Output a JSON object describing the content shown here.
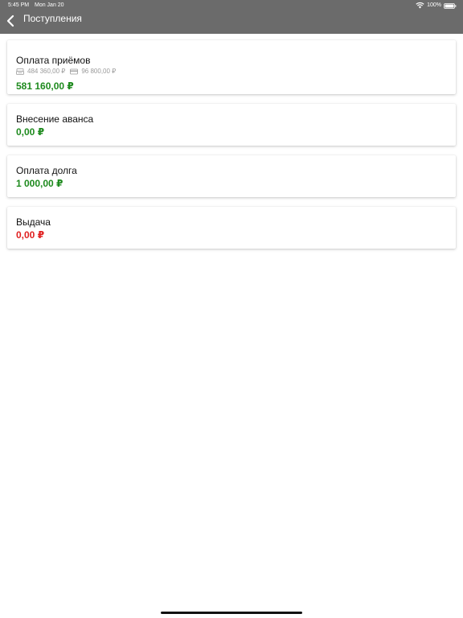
{
  "status_bar": {
    "time": "5:45 PM",
    "date": "Mon Jan 20",
    "battery": "100%"
  },
  "header": {
    "title": "Поступления",
    "back_icon": "chevron-left-icon",
    "background_color": "#6b6b6b"
  },
  "cards": [
    {
      "title": "Оплата приёмов",
      "cash": "484 360,00 ₽",
      "card": "96 800,00 ₽",
      "amount": "581 160,00 ₽",
      "amount_color": "#1e8a1e"
    },
    {
      "title": "Внесение аванса",
      "amount": "0,00 ₽",
      "amount_color": "#1e8a1e"
    },
    {
      "title": "Оплата долга",
      "amount": "1 000,00 ₽",
      "amount_color": "#1e8a1e"
    },
    {
      "title": "Выдача",
      "amount": "0,00 ₽",
      "amount_color": "#e02020"
    }
  ]
}
